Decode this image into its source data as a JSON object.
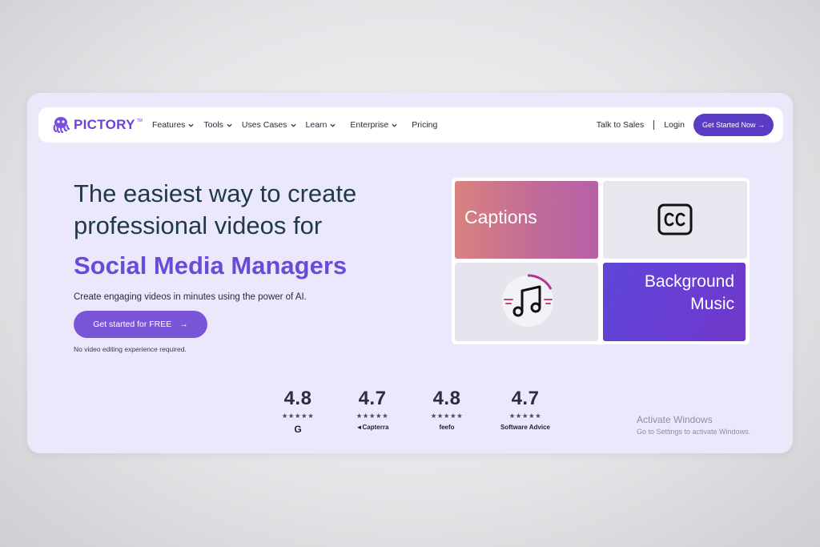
{
  "brand": {
    "name": "PICTORY",
    "tm": "TM",
    "color": "#6d3fd6"
  },
  "nav": {
    "items": [
      {
        "label": "Features",
        "has_dropdown": true
      },
      {
        "label": "Tools",
        "has_dropdown": true
      },
      {
        "label": "Uses Cases",
        "has_dropdown": true
      },
      {
        "label": "Learn",
        "has_dropdown": true
      },
      {
        "label": "Enterprise",
        "has_dropdown": true
      },
      {
        "label": "Pricing",
        "has_dropdown": false
      }
    ],
    "talk_to_sales": "Talk to Sales",
    "separator": "|",
    "login": "Login",
    "cta": "Get Started Now →"
  },
  "hero": {
    "title_line1": "The easiest way to create",
    "title_line2": "professional videos for",
    "highlight": "Social Media Managers",
    "subtitle": "Create engaging videos in minutes using the power of AI.",
    "button_label": "Get started for FREE",
    "button_arrow": "→",
    "note": "No video editing experience required."
  },
  "features": {
    "captions": "Captions",
    "cc_icon": "closed-captions-icon",
    "music_icon": "music-note-icon",
    "background_music": "Background Music"
  },
  "ratings": [
    {
      "score": "4.8",
      "stars": "★★★★★",
      "brand": "G",
      "brand_icon": "g2-icon"
    },
    {
      "score": "4.7",
      "stars": "★★★★★",
      "brand": "Capterra",
      "brand_icon": "capterra-icon"
    },
    {
      "score": "4.8",
      "stars": "★★★★★",
      "brand": "feefo",
      "brand_icon": "feefo-icon"
    },
    {
      "score": "4.7",
      "stars": "★★★★★",
      "brand": "Software Advice",
      "brand_icon": "software-advice-icon"
    }
  ],
  "watermark": {
    "title": "Activate Windows",
    "subtitle": "Go to Settings to activate Windows."
  },
  "colors": {
    "accent": "#5b3cc4",
    "highlight_text": "#6a4bd8",
    "card_bg": "#ece8fb"
  }
}
